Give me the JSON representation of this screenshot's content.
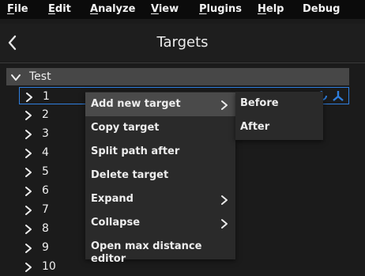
{
  "menubar": {
    "items": [
      {
        "first": "F",
        "rest": "ile"
      },
      {
        "first": "E",
        "rest": "dit"
      },
      {
        "first": "A",
        "rest": "nalyze"
      },
      {
        "first": "V",
        "rest": "iew"
      },
      {
        "first": "P",
        "rest": "lugins"
      },
      {
        "first": "H",
        "rest": "elp"
      },
      {
        "first": "",
        "rest": "Debug"
      }
    ]
  },
  "header": {
    "title": "Targets"
  },
  "tree": {
    "root_label": "Test",
    "rows": [
      "1",
      "2",
      "3",
      "4",
      "5",
      "6",
      "7",
      "8",
      "9",
      "10"
    ],
    "accent_color": "#2f7fe0"
  },
  "context_menu": {
    "items": [
      "Add new target",
      "Copy target",
      "Split path after",
      "Delete target",
      "Expand",
      "Collapse",
      "Open max distance editor"
    ]
  },
  "submenu": {
    "items": [
      "Before",
      "After"
    ]
  },
  "icons": [
    "back-arrow-icon",
    "chevron-down-icon",
    "chevron-right-icon",
    "refresh-icon",
    "axis-icon"
  ]
}
